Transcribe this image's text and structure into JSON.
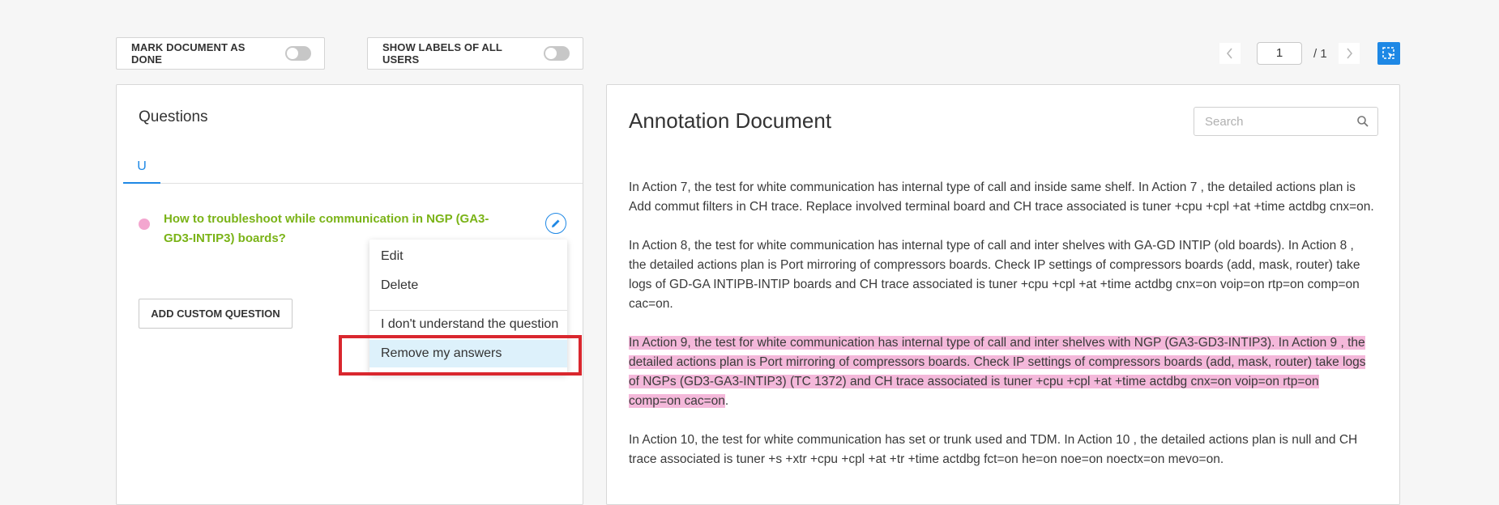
{
  "toolbar": {
    "mark_done_label": "MARK DOCUMENT AS DONE",
    "show_labels_label": "SHOW LABELS OF ALL USERS"
  },
  "pager": {
    "current_page": "1",
    "total": "/ 1",
    "prev_icon": "chevron-left-icon",
    "next_icon": "chevron-right-icon"
  },
  "questions": {
    "title": "Questions",
    "tab_label": "U",
    "item_text": "How to troubleshoot while communication in NGP (GA3-GD3-INTIP3) boards?",
    "add_custom_label": "ADD CUSTOM QUESTION",
    "question_color": "#7ab317",
    "dot_color": "#f3a6cf"
  },
  "menu": {
    "edit": "Edit",
    "delete": "Delete",
    "dont_understand": "I don't understand the question",
    "remove_answers": "Remove my answers"
  },
  "document": {
    "title": "Annotation Document",
    "search_placeholder": "Search",
    "p1": "In Action 7, the test for white communication has internal type of call and inside same shelf. In Action 7 , the detailed actions plan is Add commut filters in CH trace. Replace involved terminal board and CH trace associated is tuner +cpu +cpl +at +time actdbg cnx=on.",
    "p2": "In Action 8, the test for white communication has internal type of call and inter shelves with GA-GD INTIP (old boards). In Action 8 , the detailed actions plan is Port mirroring of compressors boards. Check IP settings of compressors boards (add, mask, router) take logs of GD-GA INTIPB-INTIP boards and CH trace associated is tuner +cpu +cpl +at +time actdbg cnx=on voip=on rtp=on comp=on cac=on.",
    "p3_highlighted": "In Action 9, the test for white communication has internal type of call and inter shelves with NGP (GA3-GD3-INTIP3). In Action 9 , the detailed actions plan is Port mirroring of compressors boards. Check IP settings of compressors boards (add, mask, router) take logs of NGPs (GD3-GA3-INTIP3) (TC 1372) and CH trace associated is tuner +cpu +cpl +at +time actdbg cnx=on voip=on rtp=on comp=on cac=on",
    "p3_tail": ".",
    "p4": "In Action 10, the test for white communication has set or trunk used and TDM. In Action 10 , the detailed actions plan is null and CH trace associated is tuner +s +xtr +cpu +cpl +at +tr +time actdbg fct=on he=on noe=on noectx=on mevo=on.",
    "highlight_color": "#f4b8da"
  },
  "colors": {
    "accent": "#1e88e5",
    "annotation_red": "#d9272e"
  }
}
